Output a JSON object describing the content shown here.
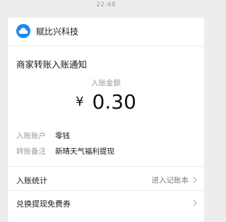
{
  "status": {
    "time": "22:48"
  },
  "app": {
    "name": "赋比兴科技",
    "icon": "cloud-icon",
    "icon_color": "#1e88f0"
  },
  "notice": {
    "title": "商家转账入账通知",
    "amount_label": "入账金额",
    "currency": "¥",
    "amount": "0.30",
    "account_label": "入账账户",
    "account_value": "零钱",
    "remark_label": "转账备注",
    "remark_value": "新晴天气福利提现"
  },
  "links": {
    "stats_label": "入账统计",
    "stats_action": "进入记账本",
    "coupon_label": "兑换提现免费券"
  }
}
